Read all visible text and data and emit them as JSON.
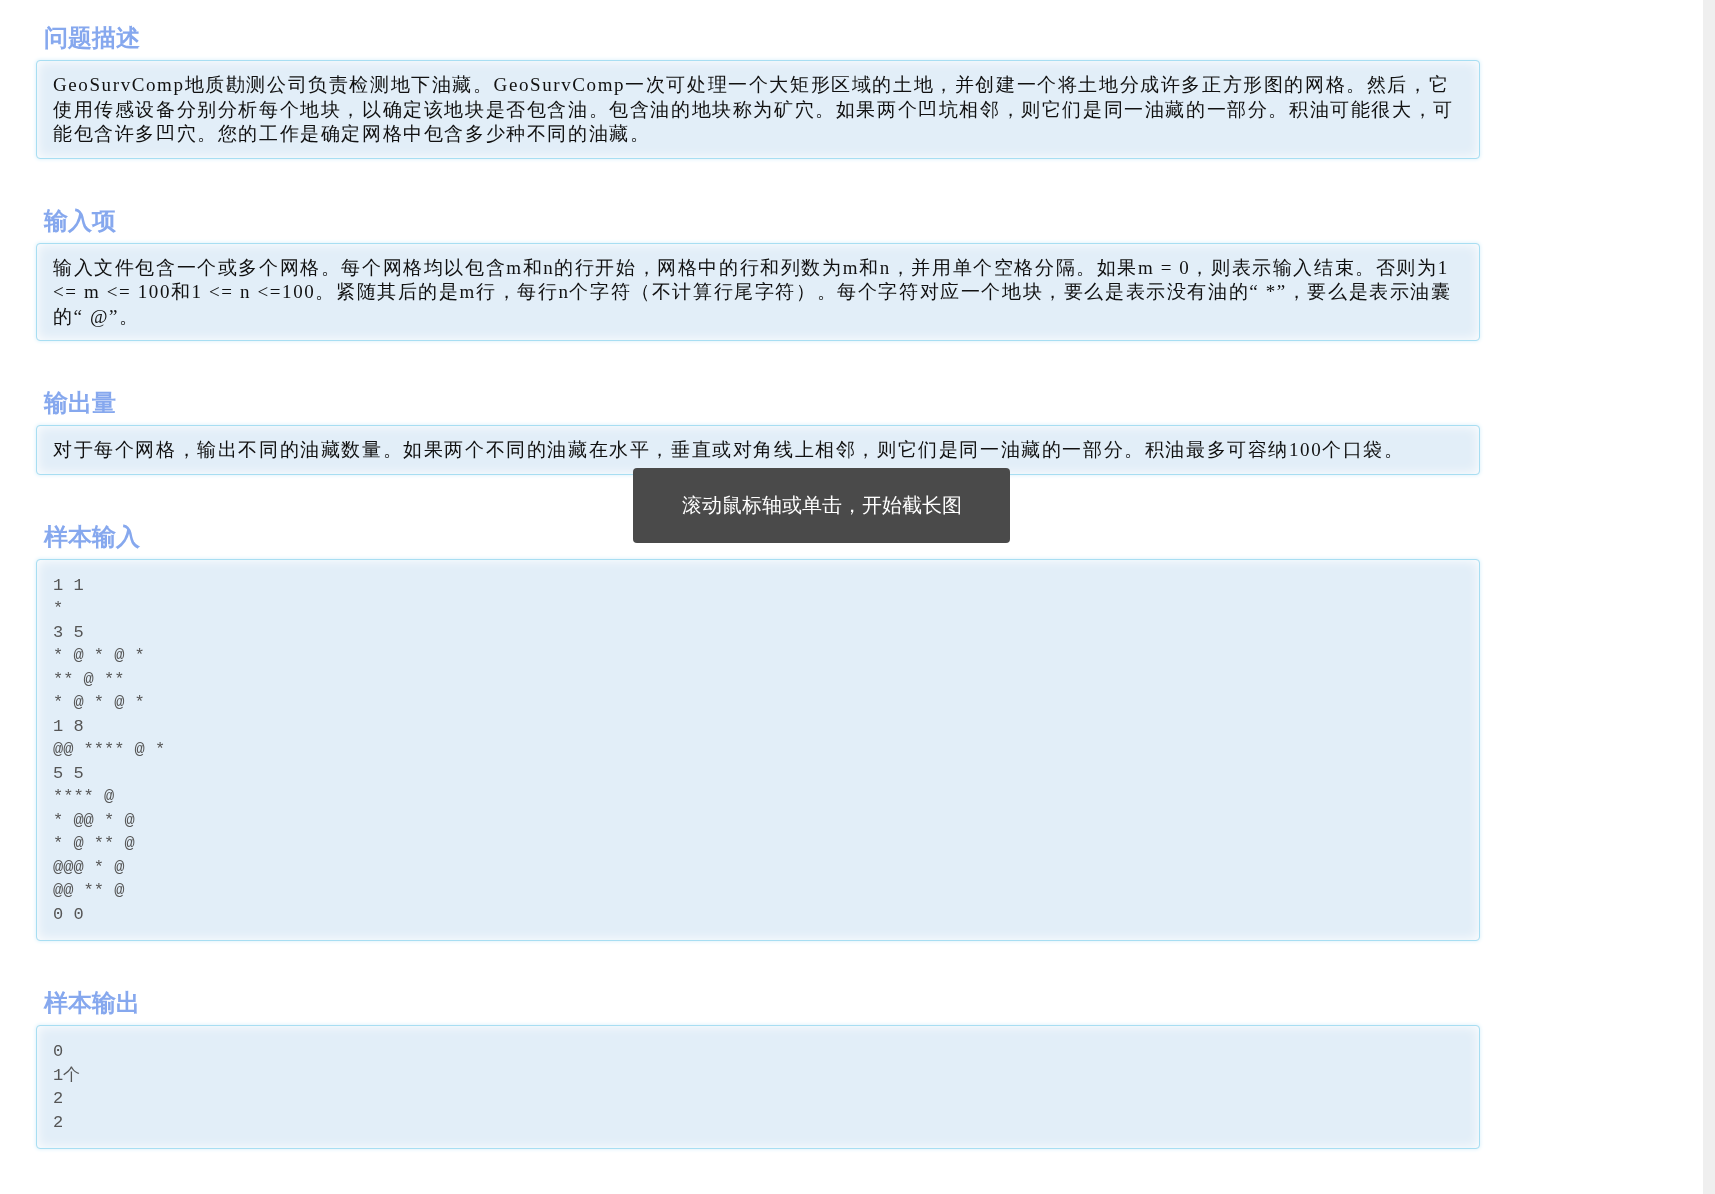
{
  "sections": [
    {
      "heading": "问题描述",
      "kind": "text",
      "text": "GeoSurvComp地质勘测公司负责检测地下油藏。GeoSurvComp一次可处理一个大矩形区域的土地，并创建一个将土地分成许多正方形图的网格。然后，它使用传感设备分别分析每个地块，以确定该地块是否包含油。包含油的地块称为矿穴。如果两个凹坑相邻，则它们是同一油藏的一部分。积油可能很大，可能包含许多凹穴。您的工作是确定网格中包含多少种不同的油藏。"
    },
    {
      "heading": "输入项",
      "kind": "text",
      "text": "输入文件包含一个或多个网格。每个网格均以包含m和n的行开始，网格中的行和列数为m和n，并用单个空格分隔。如果m = 0，则表示输入结束。否则为1 <= m <= 100和1 <= n <=100。紧随其后的是m行，每行n个字符（不计算行尾字符）。每个字符对应一个地块，要么是表示没有油的“ *”，要么是表示油囊的“ @”。"
    },
    {
      "heading": "输出量",
      "kind": "text",
      "text": "对于每个网格，输出不同的油藏数量。如果两个不同的油藏在水平，垂直或对角线上相邻，则它们是同一油藏的一部分。积油最多可容纳100个口袋。"
    },
    {
      "heading": "样本输入",
      "kind": "code",
      "lines": [
        "1 1",
        "*",
        "3 5",
        "* @ * @ *",
        "** @ **",
        "* @ * @ *",
        "1 8",
        "@@ **** @ *",
        "5 5",
        "**** @",
        "* @@ * @",
        "* @ ** @",
        "@@@ * @",
        "@@ ** @",
        "0 0"
      ]
    },
    {
      "heading": "样本输出",
      "kind": "code",
      "lines": [
        "0",
        "1个",
        "2",
        "2"
      ]
    }
  ],
  "toast": {
    "text": "滚动鼠标轴或单击，开始截长图"
  }
}
